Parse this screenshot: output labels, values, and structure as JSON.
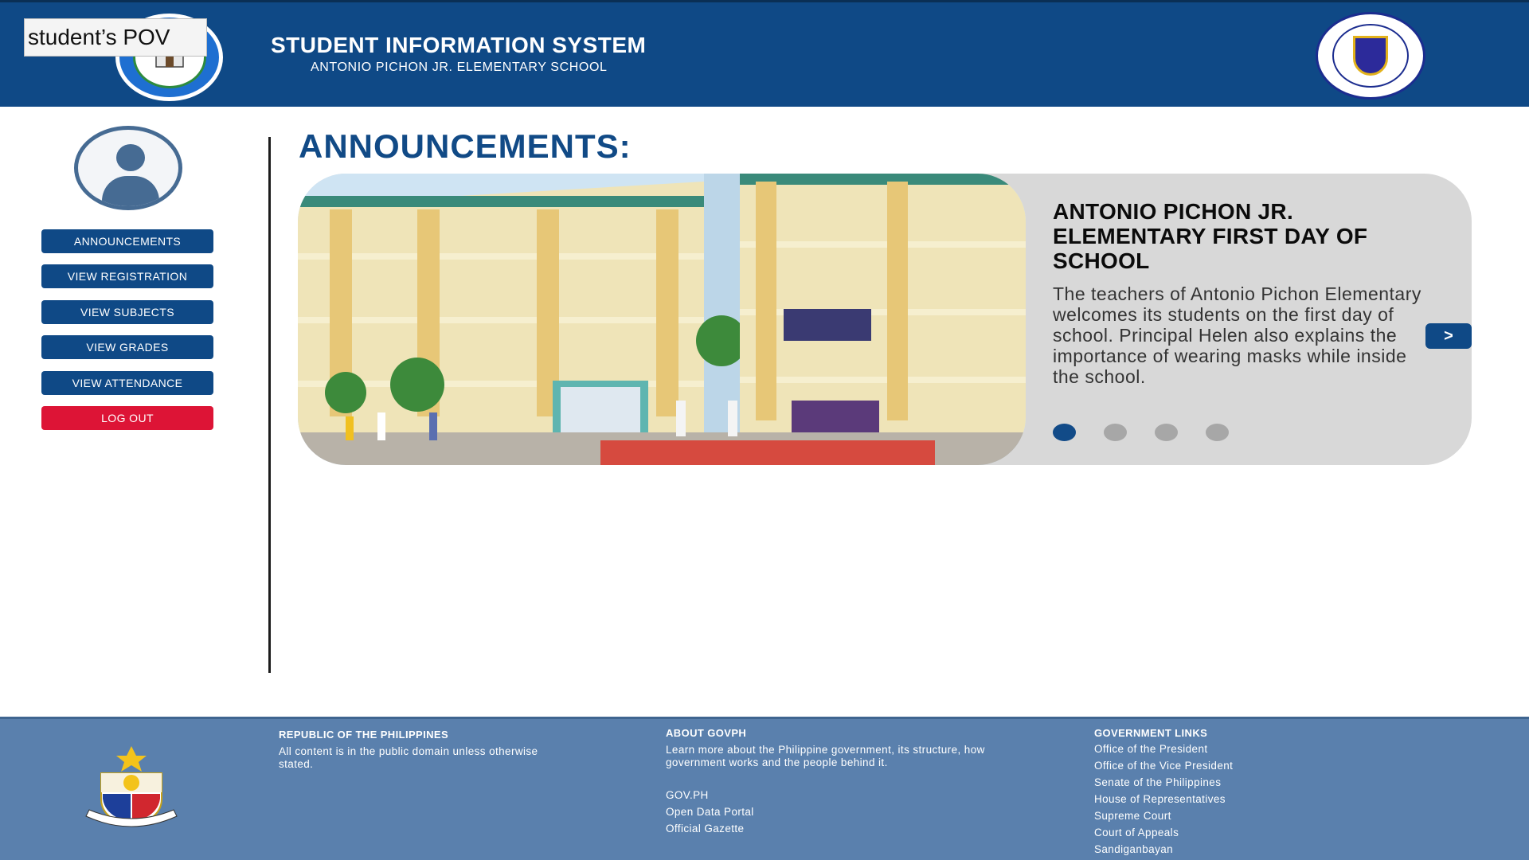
{
  "header": {
    "pov_label": "student’s POV",
    "title": "STUDENT INFORMATION SYSTEM",
    "subtitle": "ANTONIO PICHON JR. ELEMENTARY SCHOOL"
  },
  "sidebar": {
    "items": [
      {
        "label": "ANNOUNCEMENTS"
      },
      {
        "label": "VIEW REGISTRATION"
      },
      {
        "label": "VIEW SUBJECTS"
      },
      {
        "label": "VIEW GRADES"
      },
      {
        "label": "VIEW ATTENDANCE"
      },
      {
        "label": "LOG OUT"
      }
    ]
  },
  "main": {
    "heading": "ANNOUNCEMENTS:",
    "announcement": {
      "title": "ANTONIO PICHON JR. ELEMENTARY FIRST DAY OF SCHOOL",
      "body": "The teachers of Antonio Pichon Elementary welcomes its students on the first day of school. Principal Helen also explains the importance of wearing masks while inside the school.",
      "next_label": ">",
      "slide_count": 4,
      "active_slide": 1
    }
  },
  "footer": {
    "col1": {
      "heading": "REPUBLIC OF THE PHILIPPINES",
      "text": "All content is in the public domain unless otherwise stated."
    },
    "col2": {
      "heading": "ABOUT GOVPH",
      "text": "Learn more about the Philippine government, its structure, how government works and the people behind it.",
      "links": [
        "GOV.PH",
        "Open Data Portal",
        "Official Gazette"
      ]
    },
    "col3": {
      "heading": "GOVERNMENT LINKS",
      "links": [
        "Office of the President",
        "Office of the Vice President",
        "Senate of the Philippines",
        "House of Representatives",
        "Supreme Court",
        "Court of Appeals",
        "Sandiganbayan"
      ]
    }
  },
  "colors": {
    "header_bg": "#0f4986",
    "logout": "#dd1436",
    "footer_bg": "#5a80ad",
    "card_bg": "#d8d8d8"
  }
}
